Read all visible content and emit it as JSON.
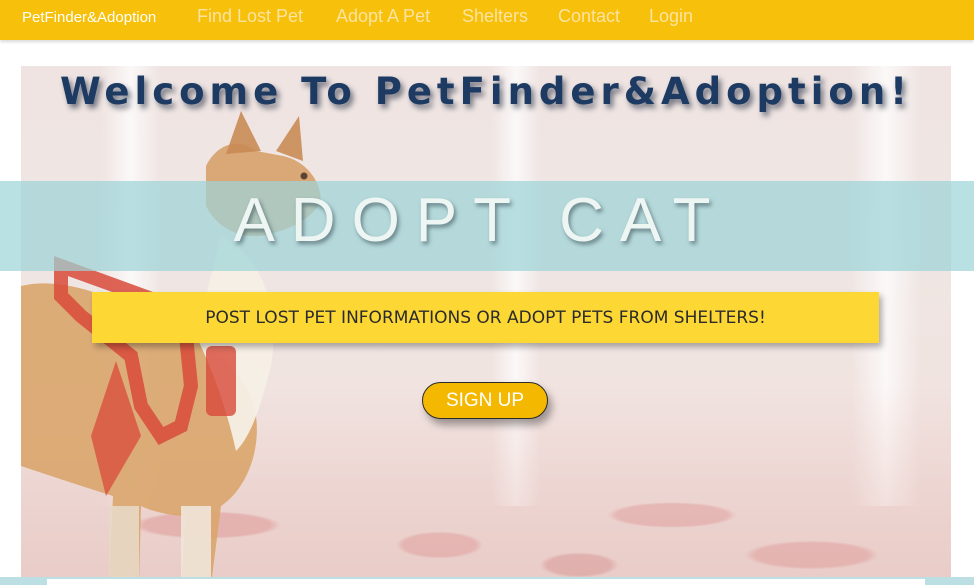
{
  "navbar": {
    "brand": "PetFinder&Adoption",
    "links": [
      {
        "label": "Find Lost Pet"
      },
      {
        "label": "Adopt A Pet"
      },
      {
        "label": "Shelters"
      },
      {
        "label": "Contact"
      },
      {
        "label": "Login"
      }
    ]
  },
  "hero": {
    "welcome": "Welcome To PetFinder&Adoption!",
    "headline": "ADOPT CAT",
    "tagline": "POST LOST PET INFORMATIONS OR ADOPT PETS FROM SHELTERS!",
    "signup_label": "SIGN UP"
  },
  "colors": {
    "navbar": "#f7c00a",
    "welcome_text": "#1d3a63",
    "headline_band": "#9ed4d8",
    "tagline_box": "#fdd835",
    "signup_button": "#f5b800"
  }
}
